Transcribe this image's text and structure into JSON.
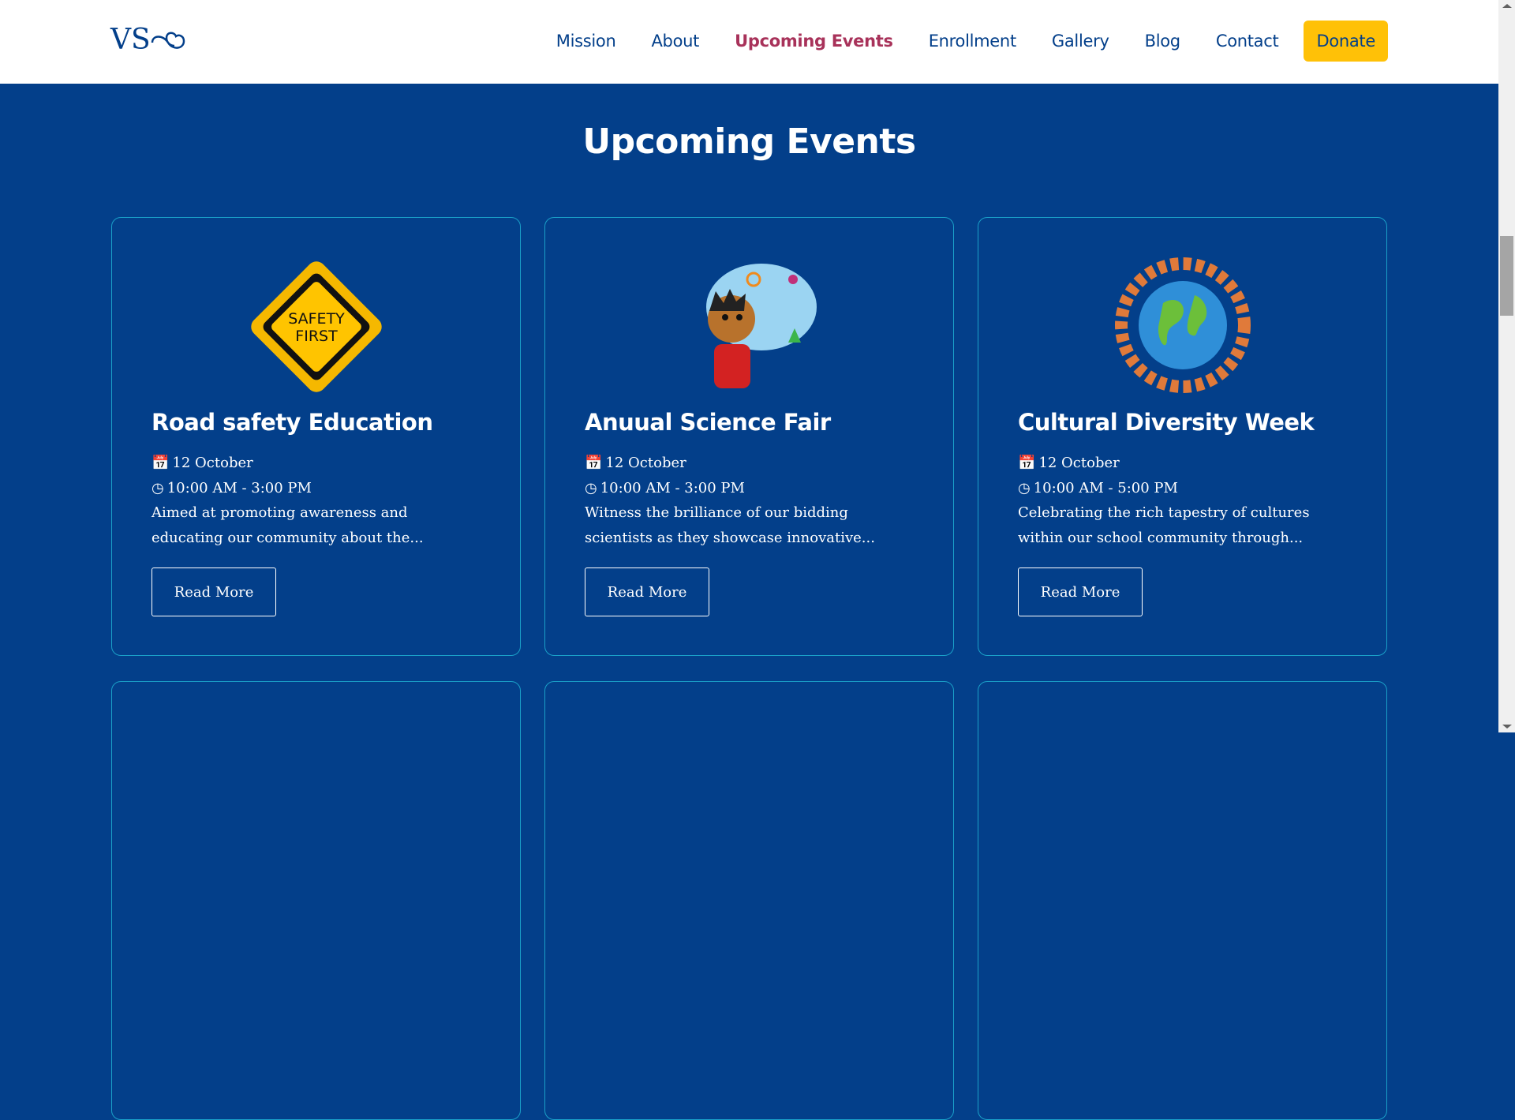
{
  "logo": {
    "text": "VS"
  },
  "nav": {
    "items": [
      {
        "label": "Mission"
      },
      {
        "label": "About"
      },
      {
        "label": "Upcoming Events",
        "active": true
      },
      {
        "label": "Enrollment"
      },
      {
        "label": "Gallery"
      },
      {
        "label": "Blog"
      },
      {
        "label": "Contact"
      }
    ],
    "donate": "Donate"
  },
  "colors": {
    "primary": "#033f8a",
    "accent": "#a8325a",
    "donate": "#ffc107",
    "card_border": "#1aa0c8"
  },
  "section": {
    "title": "Upcoming Events"
  },
  "events": [
    {
      "title": "Road safety Education",
      "date": "12 October",
      "time": "10:00 AM - 3:00 PM",
      "desc1": "Aimed at promoting awareness and",
      "desc2": "educating our community about the...",
      "button": "Read More",
      "image": "safety-first-sign",
      "sign_text1": "SAFETY",
      "sign_text2": "FIRST"
    },
    {
      "title": "Anuual Science Fair",
      "date": "12 October",
      "time": "10:00 AM - 3:00 PM",
      "desc1": "Witness the brilliance of our bidding",
      "desc2": "scientists as they showcase innovative...",
      "button": "Read More",
      "image": "science-kid"
    },
    {
      "title": "Cultural Diversity Week",
      "date": "12 October",
      "time": "10:00 AM - 5:00 PM",
      "desc1": "Celebrating the rich tapestry of cultures",
      "desc2": "within our school community through...",
      "button": "Read More",
      "image": "globe-people"
    }
  ]
}
